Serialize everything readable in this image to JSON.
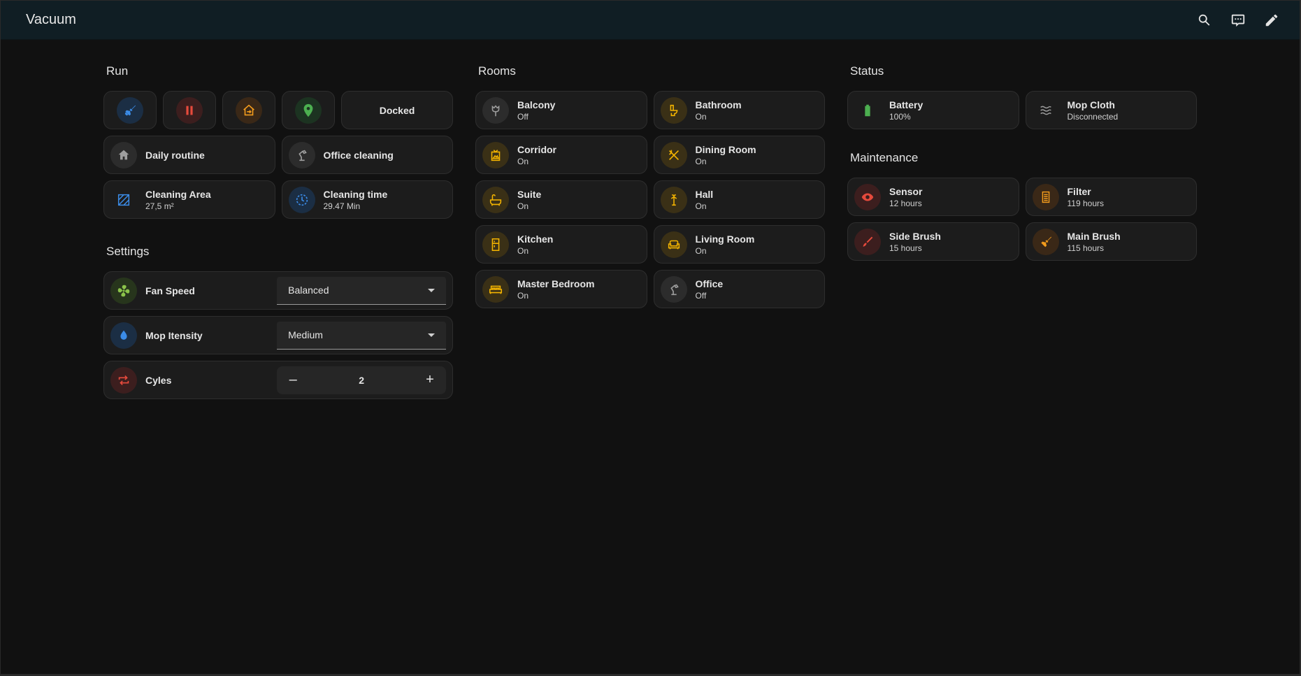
{
  "app": {
    "title": "Vacuum"
  },
  "header": {
    "actions": [
      "search-icon",
      "chat-icon",
      "edit-icon"
    ]
  },
  "colors": {
    "blue": "#3b8ce8",
    "red": "#e64a3c",
    "orange": "#f29b1d",
    "green": "#4caf50",
    "amber": "#f4b400",
    "grey": "#9e9e9e",
    "lightgreen": "#8bc34a"
  },
  "run": {
    "title": "Run",
    "buttons": [
      {
        "icon": "broom-icon",
        "color": "blue"
      },
      {
        "icon": "pause-icon",
        "color": "red"
      },
      {
        "icon": "home-return-icon",
        "color": "orange"
      },
      {
        "icon": "locate-icon",
        "color": "green"
      }
    ],
    "status": "Docked",
    "routines": [
      {
        "name": "Daily routine",
        "icon": "home-icon"
      },
      {
        "name": "Office cleaning",
        "icon": "desk-lamp-icon"
      }
    ],
    "stats": [
      {
        "name": "Cleaning Area",
        "value": "27,5 m²",
        "icon": "area-icon"
      },
      {
        "name": "Cleaning time",
        "value": "29.47 Min",
        "icon": "timer-icon"
      }
    ]
  },
  "settings": {
    "title": "Settings",
    "fan_speed": {
      "label": "Fan Speed",
      "value": "Balanced",
      "icon": "fan-icon"
    },
    "mop_intensity": {
      "label": "Mop Itensity",
      "value": "Medium",
      "icon": "water-drop-icon"
    },
    "cycles": {
      "label": "Cyles",
      "value": "2",
      "icon": "repeat-icon",
      "minus": "–",
      "plus": "+"
    }
  },
  "rooms": {
    "title": "Rooms",
    "items": [
      {
        "name": "Balcony",
        "state": "Off",
        "icon": "flower-icon"
      },
      {
        "name": "Bathroom",
        "state": "On",
        "icon": "toilet-icon"
      },
      {
        "name": "Corridor",
        "state": "On",
        "icon": "picture-frame-icon"
      },
      {
        "name": "Dining Room",
        "state": "On",
        "icon": "silverware-icon"
      },
      {
        "name": "Suite",
        "state": "On",
        "icon": "bathtub-icon"
      },
      {
        "name": "Hall",
        "state": "On",
        "icon": "coat-rack-icon"
      },
      {
        "name": "Kitchen",
        "state": "On",
        "icon": "fridge-icon"
      },
      {
        "name": "Living Room",
        "state": "On",
        "icon": "sofa-icon"
      },
      {
        "name": "Master Bedroom",
        "state": "On",
        "icon": "bed-icon"
      },
      {
        "name": "Office",
        "state": "Off",
        "icon": "desk-lamp-icon"
      }
    ]
  },
  "status": {
    "title": "Status",
    "items": [
      {
        "name": "Battery",
        "value": "100%",
        "icon": "battery-icon"
      },
      {
        "name": "Mop Cloth",
        "value": "Disconnected",
        "icon": "waves-icon"
      }
    ]
  },
  "maintenance": {
    "title": "Maintenance",
    "items": [
      {
        "name": "Sensor",
        "value": "12 hours",
        "icon": "eye-icon"
      },
      {
        "name": "Filter",
        "value": "119 hours",
        "icon": "filter-icon"
      },
      {
        "name": "Side Brush",
        "value": "15 hours",
        "icon": "brush-icon"
      },
      {
        "name": "Main Brush",
        "value": "115 hours",
        "icon": "broom-icon"
      }
    ]
  }
}
